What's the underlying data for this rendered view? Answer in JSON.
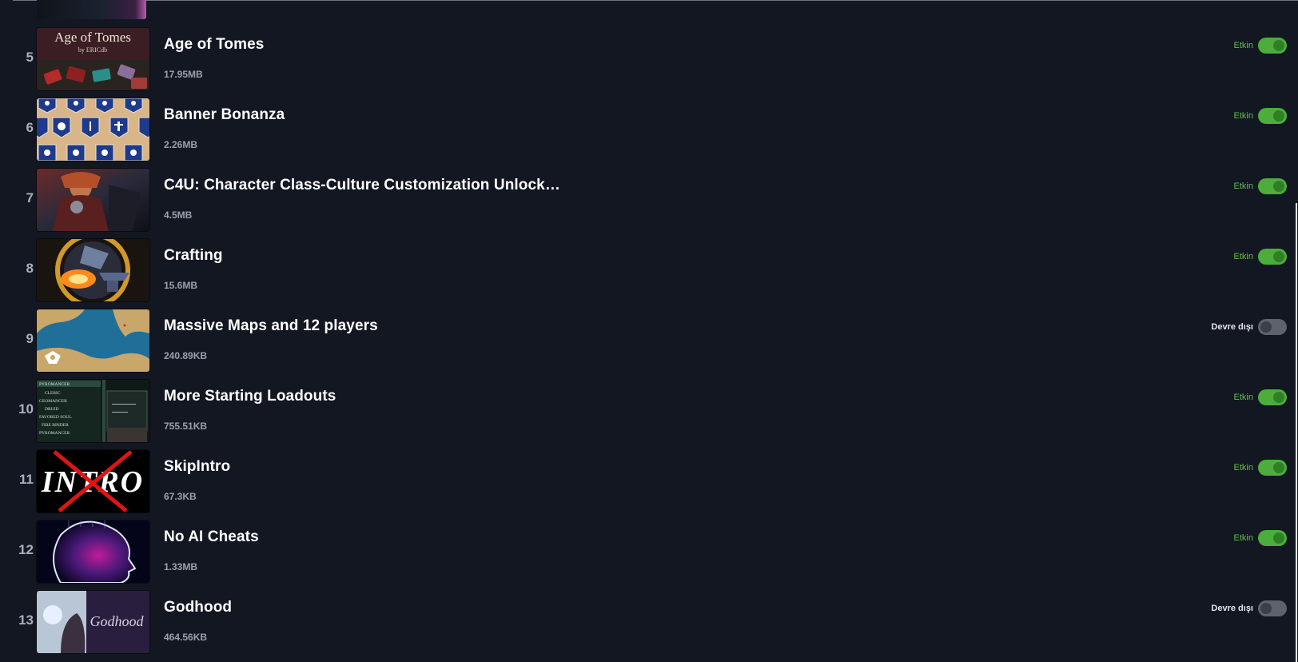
{
  "mods": [
    {
      "index": "5",
      "title": "Age of Tomes",
      "size": "17.95MB",
      "status": "Etkin",
      "enabled": true,
      "thumb_text": "Age of Tomes",
      "thumb_sub": "by ERICdb"
    },
    {
      "index": "6",
      "title": "Banner Bonanza",
      "size": "2.26MB",
      "status": "Etkin",
      "enabled": true
    },
    {
      "index": "7",
      "title": "C4U: Character Class-Culture Customization Unlock…",
      "size": "4.5MB",
      "status": "Etkin",
      "enabled": true
    },
    {
      "index": "8",
      "title": "Crafting",
      "size": "15.6MB",
      "status": "Etkin",
      "enabled": true
    },
    {
      "index": "9",
      "title": "Massive Maps and 12 players",
      "size": "240.89KB",
      "status": "Devre dışı",
      "enabled": false
    },
    {
      "index": "10",
      "title": "More Starting Loadouts",
      "size": "755.51KB",
      "status": "Etkin",
      "enabled": true,
      "thumb_lines": [
        "PYROMANCER",
        "CLERIC",
        "GEOMANCER",
        "DRUID",
        "FAVORED SOUL",
        "FIRE BINDER",
        "PYROMANCER"
      ]
    },
    {
      "index": "11",
      "title": "SkipIntro",
      "size": "67.3KB",
      "status": "Etkin",
      "enabled": true,
      "thumb_text": "INTRO"
    },
    {
      "index": "12",
      "title": "No AI Cheats",
      "size": "1.33MB",
      "status": "Etkin",
      "enabled": true
    },
    {
      "index": "13",
      "title": "Godhood",
      "size": "464.56KB",
      "status": "Devre dışı",
      "enabled": false,
      "thumb_text": "Godhood"
    }
  ],
  "colors": {
    "background": "#131722",
    "enabled_green": "#4cad3c",
    "disabled_gray": "#5e626c",
    "enabled_label": "#5fbf4c"
  }
}
